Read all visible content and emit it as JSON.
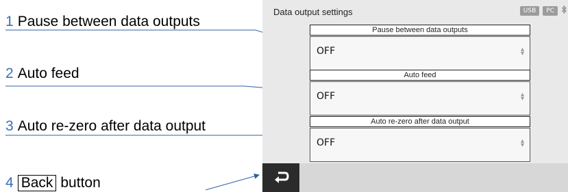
{
  "annotations": [
    {
      "num": "1",
      "text": "Pause between data outputs"
    },
    {
      "num": "2",
      "text": "Auto feed"
    },
    {
      "num": "3",
      "text": "Auto re-zero after data output"
    },
    {
      "num": "4",
      "boxed": "Back",
      "text": "button"
    }
  ],
  "screen": {
    "title": "Data output settings",
    "status": {
      "usb": "USB",
      "pc": "PC",
      "bluetooth": "bluetooth-icon"
    }
  },
  "settings": [
    {
      "label": "Pause between data outputs",
      "value": "OFF"
    },
    {
      "label": "Auto feed",
      "value": "OFF"
    },
    {
      "label": "Auto re-zero after data output",
      "value": "OFF"
    }
  ],
  "footer": {
    "back_icon": "back-arrow-icon"
  },
  "colors": {
    "accent": "#3a6fb5",
    "screen_bg": "#e9e9e9",
    "back_button": "#2b2b2b"
  }
}
